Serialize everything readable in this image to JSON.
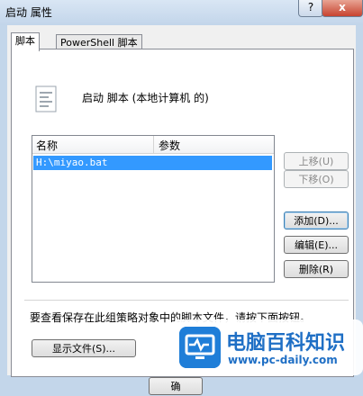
{
  "window": {
    "title": "启动 属性",
    "help_label": "?",
    "close_label": "x"
  },
  "tabs": [
    {
      "label": "脚本",
      "active": true
    },
    {
      "label": "PowerShell 脚本",
      "active": false
    }
  ],
  "heading": "启动 脚本 (本地计算机 的)",
  "list": {
    "columns": [
      "名称",
      "参数"
    ],
    "rows": [
      {
        "name": "H:\\miyao.bat",
        "params": ""
      }
    ]
  },
  "buttons": {
    "up": "上移(U)",
    "down": "下移(O)",
    "add": "添加(D)...",
    "edit": "编辑(E)...",
    "delete": "删除(R)",
    "show_files": "显示文件(S)...",
    "ok": "确"
  },
  "hint": "要查看保存在此组策略对象中的脚本文件，请按下面按钮。",
  "watermark": {
    "name": "电脑百科知识",
    "url": "www.pc-daily.com"
  },
  "colors": {
    "selection": "#3399ff",
    "brand": "#1f7ed8"
  }
}
